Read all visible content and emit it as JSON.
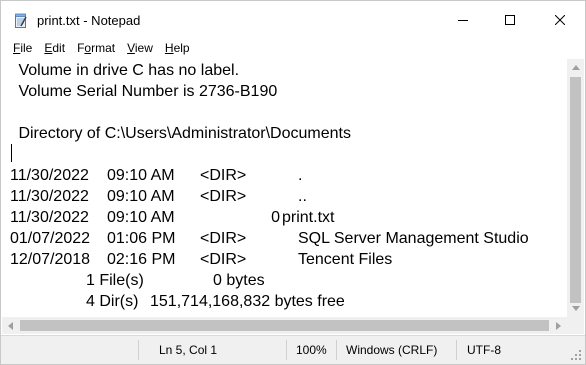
{
  "window": {
    "title": "print.txt - Notepad"
  },
  "menu": {
    "file": {
      "ul": "F",
      "rest": "ile"
    },
    "edit": {
      "ul": "E",
      "rest": "dit"
    },
    "format": {
      "pre": "F",
      "ul": "o",
      "rest": "rmat"
    },
    "view": {
      "ul": "V",
      "rest": "iew"
    },
    "help": {
      "ul": "H",
      "rest": "elp"
    }
  },
  "editor": {
    "lines": [
      " Volume in drive C has no label.",
      " Volume Serial Number is 2736-B190",
      "",
      " Directory of C:\\Users\\Administrator\\Documents",
      "",
      "11/30/2022  09:10 AM    <DIR>          .",
      "11/30/2022  09:10 AM    <DIR>          ..",
      "11/30/2022  09:10 AM                 0 print.txt",
      "01/07/2022  01:06 PM    <DIR>          SQL Server Management Studio",
      "12/07/2018  02:16 PM    <DIR>          Tencent Files",
      "               1 File(s)              0 bytes",
      "               4 Dir(s)  151,714,168,832 bytes free"
    ]
  },
  "status": {
    "position": "Ln 5, Col 1",
    "zoom": "100%",
    "line_ending": "Windows (CRLF)",
    "encoding": "UTF-8"
  }
}
